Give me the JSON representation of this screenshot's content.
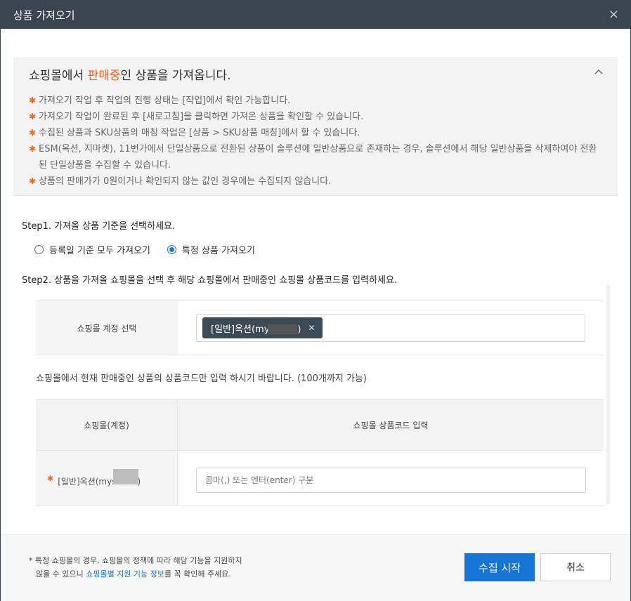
{
  "window": {
    "title": "상품 가져오기",
    "close_icon": "×"
  },
  "notice": {
    "headline_prefix": "쇼핑몰에서 ",
    "headline_highlight": "판매중",
    "headline_suffix": "인 상품을 가져옵니다.",
    "items": [
      "가져오기 작업 후 작업의 진행 상태는 [작업]에서 확인 가능합니다.",
      "가져오기 작업이 완료된 후 [새로고침]을 클릭하면 가져온 상품을 확인할 수 있습니다.",
      "수집된 상품과 SKU상품의 매칭 작업은 [상품 > SKU상품 매칭]에서 할 수 있습니다.",
      "ESM(옥션, 지마켓), 11번가에서 단일상품으로 전환된 상품이 솔루션에 일반상품으로 존재하는 경우, 솔루션에서 해당 일반상품을 삭제하여야 전환된 단일상품을 수집할 수 있습니다.",
      "상품의 판매가가 0원이거나 확인되지 않는 값인 경우에는 수집되지 않습니다."
    ],
    "accent_color": "#f26522"
  },
  "step1": {
    "label": "Step1. 가져올 상품 기준을 선택하세요.",
    "options": [
      "등록일 기준 모두 가져오기",
      "특정 상품 가져오기"
    ],
    "selected": "특정 상품 가져오기"
  },
  "step2": {
    "label": "Step2. 상품을 가져올 쇼핑몰을 선택 후 해당 쇼핑몰에서 판매중인 쇼핑몰 상품코드를 입력하세요.",
    "account_label": "쇼핑몰 계정 선택",
    "account_tag_prefix": "[일반]옥션(my",
    "account_tag_suffix": ")",
    "hint": "쇼핑몰에서 현재 판매중인 상품의 상품코드만 입력 하시기 바랍니다. (100개까지 가능)",
    "table": {
      "col1": "쇼핑몰(계정)",
      "col2": "쇼핑몰 상품코드 입력",
      "row_label_prefix": "[일반]옥션(mys",
      "row_label_suffix": ")",
      "input_placeholder": "콤마(,) 또는 엔터(enter) 구분",
      "input_value": ""
    }
  },
  "footer": {
    "note_prefix": "* 특정 쇼핑몰의 경우, 쇼핑몰의 정책에 따라 해당 기능을 지원하지",
    "note_line2_prefix": "않을 수 있으니 ",
    "note_link": "쇼핑몰별 지원 기능 정보",
    "note_line2_suffix": "를 꼭 확인해 주세요.",
    "primary_button": "수집 시작",
    "cancel_button": "취소",
    "primary_color": "#1574d4"
  }
}
